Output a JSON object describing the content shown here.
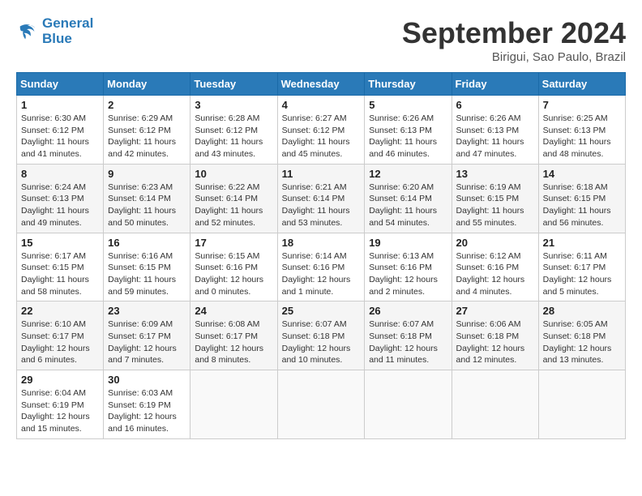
{
  "header": {
    "logo_line1": "General",
    "logo_line2": "Blue",
    "month_title": "September 2024",
    "location": "Birigui, Sao Paulo, Brazil"
  },
  "days_of_week": [
    "Sunday",
    "Monday",
    "Tuesday",
    "Wednesday",
    "Thursday",
    "Friday",
    "Saturday"
  ],
  "weeks": [
    [
      {
        "day": "1",
        "sunrise": "6:30 AM",
        "sunset": "6:12 PM",
        "daylight": "11 hours and 41 minutes."
      },
      {
        "day": "2",
        "sunrise": "6:29 AM",
        "sunset": "6:12 PM",
        "daylight": "11 hours and 42 minutes."
      },
      {
        "day": "3",
        "sunrise": "6:28 AM",
        "sunset": "6:12 PM",
        "daylight": "11 hours and 43 minutes."
      },
      {
        "day": "4",
        "sunrise": "6:27 AM",
        "sunset": "6:12 PM",
        "daylight": "11 hours and 45 minutes."
      },
      {
        "day": "5",
        "sunrise": "6:26 AM",
        "sunset": "6:13 PM",
        "daylight": "11 hours and 46 minutes."
      },
      {
        "day": "6",
        "sunrise": "6:26 AM",
        "sunset": "6:13 PM",
        "daylight": "11 hours and 47 minutes."
      },
      {
        "day": "7",
        "sunrise": "6:25 AM",
        "sunset": "6:13 PM",
        "daylight": "11 hours and 48 minutes."
      }
    ],
    [
      {
        "day": "8",
        "sunrise": "6:24 AM",
        "sunset": "6:13 PM",
        "daylight": "11 hours and 49 minutes."
      },
      {
        "day": "9",
        "sunrise": "6:23 AM",
        "sunset": "6:14 PM",
        "daylight": "11 hours and 50 minutes."
      },
      {
        "day": "10",
        "sunrise": "6:22 AM",
        "sunset": "6:14 PM",
        "daylight": "11 hours and 52 minutes."
      },
      {
        "day": "11",
        "sunrise": "6:21 AM",
        "sunset": "6:14 PM",
        "daylight": "11 hours and 53 minutes."
      },
      {
        "day": "12",
        "sunrise": "6:20 AM",
        "sunset": "6:14 PM",
        "daylight": "11 hours and 54 minutes."
      },
      {
        "day": "13",
        "sunrise": "6:19 AM",
        "sunset": "6:15 PM",
        "daylight": "11 hours and 55 minutes."
      },
      {
        "day": "14",
        "sunrise": "6:18 AM",
        "sunset": "6:15 PM",
        "daylight": "11 hours and 56 minutes."
      }
    ],
    [
      {
        "day": "15",
        "sunrise": "6:17 AM",
        "sunset": "6:15 PM",
        "daylight": "11 hours and 58 minutes."
      },
      {
        "day": "16",
        "sunrise": "6:16 AM",
        "sunset": "6:15 PM",
        "daylight": "11 hours and 59 minutes."
      },
      {
        "day": "17",
        "sunrise": "6:15 AM",
        "sunset": "6:16 PM",
        "daylight": "12 hours and 0 minutes."
      },
      {
        "day": "18",
        "sunrise": "6:14 AM",
        "sunset": "6:16 PM",
        "daylight": "12 hours and 1 minute."
      },
      {
        "day": "19",
        "sunrise": "6:13 AM",
        "sunset": "6:16 PM",
        "daylight": "12 hours and 2 minutes."
      },
      {
        "day": "20",
        "sunrise": "6:12 AM",
        "sunset": "6:16 PM",
        "daylight": "12 hours and 4 minutes."
      },
      {
        "day": "21",
        "sunrise": "6:11 AM",
        "sunset": "6:17 PM",
        "daylight": "12 hours and 5 minutes."
      }
    ],
    [
      {
        "day": "22",
        "sunrise": "6:10 AM",
        "sunset": "6:17 PM",
        "daylight": "12 hours and 6 minutes."
      },
      {
        "day": "23",
        "sunrise": "6:09 AM",
        "sunset": "6:17 PM",
        "daylight": "12 hours and 7 minutes."
      },
      {
        "day": "24",
        "sunrise": "6:08 AM",
        "sunset": "6:17 PM",
        "daylight": "12 hours and 8 minutes."
      },
      {
        "day": "25",
        "sunrise": "6:07 AM",
        "sunset": "6:18 PM",
        "daylight": "12 hours and 10 minutes."
      },
      {
        "day": "26",
        "sunrise": "6:07 AM",
        "sunset": "6:18 PM",
        "daylight": "12 hours and 11 minutes."
      },
      {
        "day": "27",
        "sunrise": "6:06 AM",
        "sunset": "6:18 PM",
        "daylight": "12 hours and 12 minutes."
      },
      {
        "day": "28",
        "sunrise": "6:05 AM",
        "sunset": "6:18 PM",
        "daylight": "12 hours and 13 minutes."
      }
    ],
    [
      {
        "day": "29",
        "sunrise": "6:04 AM",
        "sunset": "6:19 PM",
        "daylight": "12 hours and 15 minutes."
      },
      {
        "day": "30",
        "sunrise": "6:03 AM",
        "sunset": "6:19 PM",
        "daylight": "12 hours and 16 minutes."
      },
      null,
      null,
      null,
      null,
      null
    ]
  ],
  "labels": {
    "sunrise": "Sunrise:",
    "sunset": "Sunset:",
    "daylight": "Daylight hours"
  }
}
